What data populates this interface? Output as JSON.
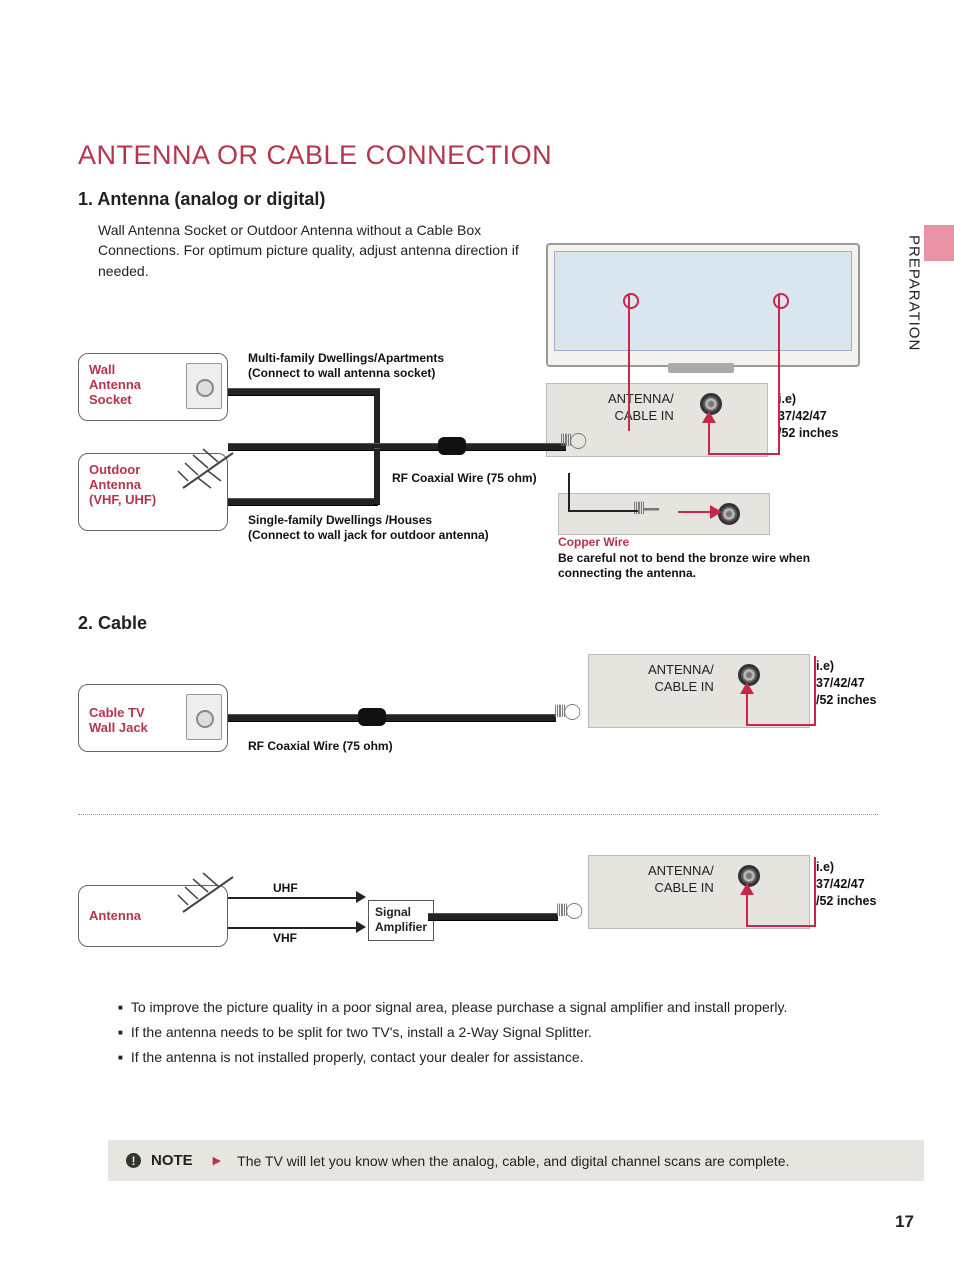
{
  "sideTab": "PREPARATION",
  "title": "ANTENNA OR CABLE CONNECTION",
  "section1": {
    "heading": "1. Antenna (analog or digital)",
    "intro": "Wall Antenna Socket or Outdoor Antenna without a Cable Box Connections. For optimum picture quality, adjust antenna direction if needed.",
    "wallSocket": "Wall\nAntenna\nSocket",
    "outdoor": "Outdoor\nAntenna\n(VHF, UHF)",
    "multi": "Multi-family Dwellings/Apartments\n(Connect to wall antenna socket)",
    "single": "Single-family Dwellings /Houses\n(Connect to wall jack for outdoor antenna)",
    "rf": "RF Coaxial Wire (75 ohm)",
    "cableIn": "ANTENNA/\nCABLE IN",
    "sizes": "i.e)\n37/42/47\n/52 inches",
    "copper": "Copper Wire",
    "copperWarn": "Be careful not to bend the bronze wire when connecting the antenna."
  },
  "section2": {
    "heading": "2. Cable",
    "cableJack": "Cable TV\nWall Jack",
    "rf": "RF Coaxial Wire (75 ohm)",
    "cableIn": "ANTENNA/\nCABLE IN",
    "sizes": "i.e)\n37/42/47\n/52 inches"
  },
  "section3": {
    "antenna": "Antenna",
    "uhf": "UHF",
    "vhf": "VHF",
    "amp": "Signal\nAmplifier",
    "cableIn": "ANTENNA/\nCABLE IN",
    "sizes": "i.e)\n37/42/47\n/52 inches"
  },
  "tips": [
    "To improve the picture quality in a poor signal area, please purchase a signal amplifier and install properly.",
    "If the antenna needs to be split for two TV's, install a 2-Way Signal Splitter.",
    "If the antenna is not installed properly, contact your dealer for assistance."
  ],
  "note": {
    "label": "NOTE",
    "text": "The TV will let you know when the analog, cable, and digital channel scans are complete."
  },
  "pageNumber": "17"
}
